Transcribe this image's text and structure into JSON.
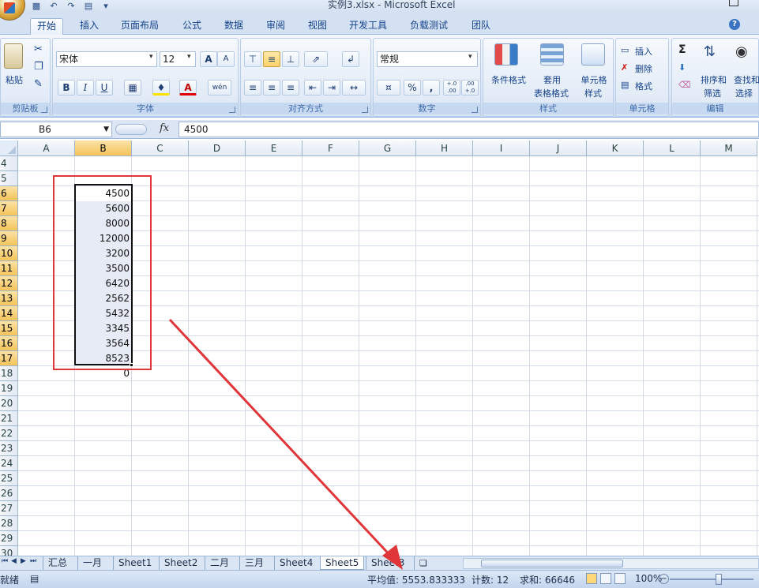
{
  "window": {
    "title": "实例3.xlsx - Microsoft Excel"
  },
  "ribbon_tabs": [
    "开始",
    "插入",
    "页面布局",
    "公式",
    "数据",
    "审阅",
    "视图",
    "开发工具",
    "负载测试",
    "团队"
  ],
  "clipboard": {
    "paste_label": "粘贴",
    "group_label": "剪贴板"
  },
  "font": {
    "name": "宋体",
    "size": "12",
    "bold": "B",
    "italic": "I",
    "underline": "U",
    "font_color_glyph": "A",
    "phonetic_glyph": "wén",
    "grow": "A",
    "shrink": "A",
    "group_label": "字体"
  },
  "alignment": {
    "group_label": "对齐方式"
  },
  "number": {
    "format": "常规",
    "percent": "%",
    "comma": ",",
    "inc_dec_1": "+.0 .00",
    "inc_dec_2": ".00 +.0",
    "group_label": "数字"
  },
  "styles": {
    "conditional": "条件格式",
    "table_format_1": "套用",
    "table_format_2": "表格格式",
    "cell_style_1": "单元格",
    "cell_style_2": "样式",
    "group_label": "样式"
  },
  "cells": {
    "insert": "插入",
    "delete": "删除",
    "format": "格式",
    "group_label": "单元格"
  },
  "editing": {
    "sort_1": "排序和",
    "sort_2": "筛选",
    "find_1": "查找和",
    "find_2": "选择",
    "sigma": "Σ",
    "group_label": "编辑"
  },
  "formula_bar": {
    "name_box": "B6",
    "fx": "fx",
    "value": "4500"
  },
  "columns": [
    "A",
    "B",
    "C",
    "D",
    "E",
    "F",
    "G",
    "H",
    "I",
    "J",
    "K",
    "L",
    "M"
  ],
  "selected_column": "B",
  "rows": [
    "4",
    "5",
    "6",
    "7",
    "8",
    "9",
    "10",
    "11",
    "12",
    "13",
    "14",
    "15",
    "16",
    "17",
    "18",
    "19",
    "20",
    "21",
    "22",
    "23",
    "24",
    "25",
    "26",
    "27",
    "28",
    "29",
    "30"
  ],
  "column_b_values": [
    "",
    "",
    "4500",
    "5600",
    "8000",
    "12000",
    "3200",
    "3500",
    "6420",
    "2562",
    "5432",
    "3345",
    "3564",
    "8523",
    "0"
  ],
  "sheet_tabs": [
    "汇总",
    "一月",
    "Sheet1",
    "Sheet2",
    "二月",
    "三月",
    "Sheet4",
    "Sheet5",
    "Sheet3"
  ],
  "active_sheet": "Sheet5",
  "status": {
    "mode": "就绪",
    "average": "平均值: 5553.833333",
    "count": "计数: 12",
    "sum": "求和: 66646",
    "zoom": "100%"
  },
  "colors": {
    "annotation": "#e0363a",
    "ribbon": "#dce7f5",
    "selected_header": "#f5c35a"
  }
}
